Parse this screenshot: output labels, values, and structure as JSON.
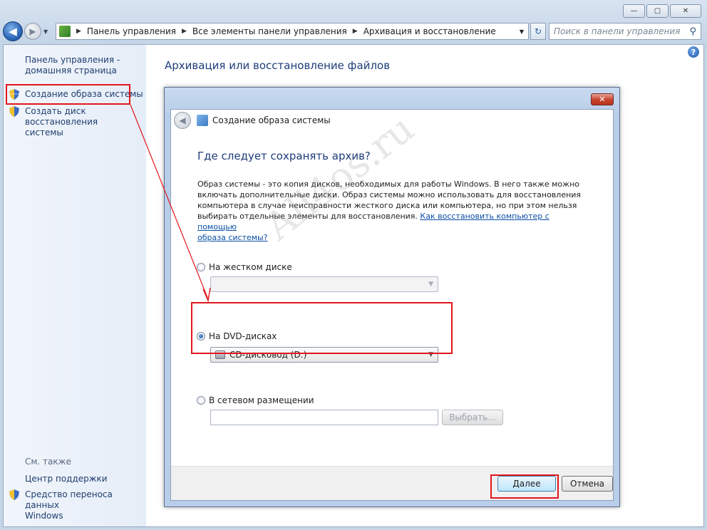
{
  "window": {
    "caption_buttons": {
      "minimize": "—",
      "maximize": "▢",
      "close": "✕"
    }
  },
  "nav": {
    "breadcrumbs": [
      "Панель управления",
      "Все элементы панели управления",
      "Архивация и восстановление"
    ],
    "search_placeholder": "Поиск в панели управления"
  },
  "sidebar": {
    "home_link": [
      "Панель управления -",
      "домашняя страница"
    ],
    "items": [
      {
        "label": "Создание образа системы",
        "icon": "shield-icon"
      },
      {
        "label": [
          "Создать диск восстановления",
          "системы"
        ],
        "icon": "shield-icon"
      }
    ],
    "see_also": "См. также",
    "see_also_items": [
      {
        "label": "Центр поддержки"
      },
      {
        "label": [
          "Средство переноса данных",
          "Windows"
        ],
        "icon": "shield-icon"
      }
    ]
  },
  "main": {
    "title": "Архивация или восстановление файлов"
  },
  "dialog": {
    "title": "Создание образа системы",
    "heading": "Где следует сохранять архив?",
    "description_lines": [
      "Образ системы - это копия дисков, необходимых для работы Windows. В него также можно",
      "включать дополнительные диски. Образ системы можно использовать для восстановления",
      "компьютера в случае неисправности жесткого диска или компьютера, но при этом нельзя",
      "выбирать отдельные элементы для восстановления. "
    ],
    "help_link_part1": "Как восстановить компьютер с помощью",
    "help_link_part2": "образа системы?",
    "options": [
      {
        "label": "На жестком диске",
        "selected": false,
        "value": ""
      },
      {
        "label": "На DVD-дисках",
        "selected": true,
        "value": "CD-дисковод (D:)"
      },
      {
        "label": "В сетевом размещении",
        "selected": false,
        "value": ""
      }
    ],
    "browse_button": "Выбрать...",
    "next_button": "Далее",
    "cancel_button": "Отмена"
  },
  "watermark": "All4os.ru",
  "colors": {
    "highlight": "#e3161d",
    "link": "#1f3e6e",
    "heading": "#1e3d7a"
  }
}
